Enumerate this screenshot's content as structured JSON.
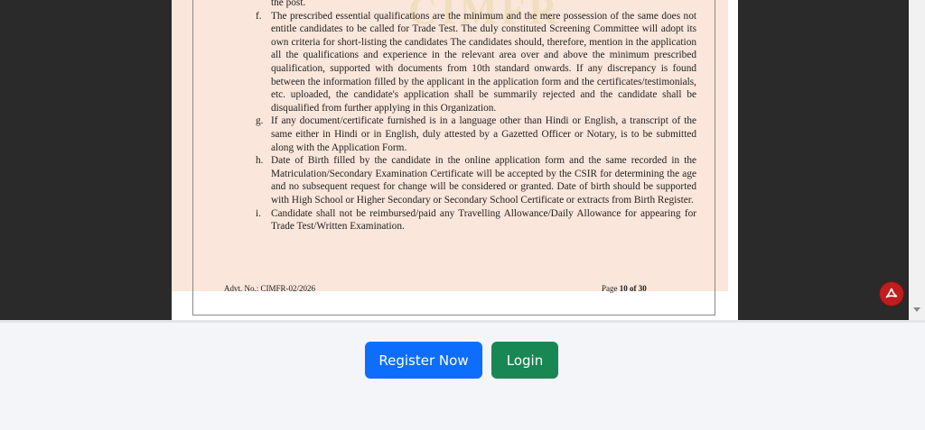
{
  "pdf_viewer": {
    "document": {
      "intro_line": "the post.",
      "items": [
        {
          "marker": "f.",
          "text": "The prescribed essential qualifications are the minimum and the mere possession of the same does not entitle candidates to be called for Trade Test. The duly constituted Screening Committee will adopt its own criteria for short-listing the candidates The candidates should, therefore, mention in the application all the qualifications and experience in the relevant area over and above the minimum prescribed qualification, supported with documents from 10th standard onwards. If any discrepancy is found between the information filled by the applicant in the application form and the certificates/testimonials, etc. uploaded, the candidate's application shall be summarily rejected and the candidate shall be disqualified from further applying in this Organization."
        },
        {
          "marker": "g.",
          "text": "If any document/certificate furnished is in a language other than Hindi or English, a transcript of the same either in Hindi or in English, duly attested by a Gazetted Officer or Notary, is to be submitted along with the Application Form."
        },
        {
          "marker": "h.",
          "text": "Date of Birth filled by the candidate in the online application form and the same recorded in the Matriculation/Secondary Examination Certificate will be accepted by the CSIR for determining the age and no subsequent request for change will be considered or granted. Date of birth should be supported with High School or Higher Secondary or Secondary School Certificate or extracts from Birth Register."
        },
        {
          "marker": "i.",
          "text": "Candidate shall not be reimbursed/paid any Travelling Allowance/Daily Allowance for appearing for Trade Test/Written Examination."
        }
      ],
      "footer": {
        "advt": "Advt. No.: CIMFR-02/2026",
        "page_word": "Page",
        "page_current": "10",
        "page_of": "of",
        "page_total": "30"
      },
      "watermark": "CIMFR"
    },
    "pdf_icon": "adobe-pdf-icon",
    "pdf_icon_color": "#bf1e1e"
  },
  "actions": {
    "register_label": "Register Now",
    "register_color": "#0d6efd",
    "login_label": "Login",
    "login_color": "#198754"
  }
}
